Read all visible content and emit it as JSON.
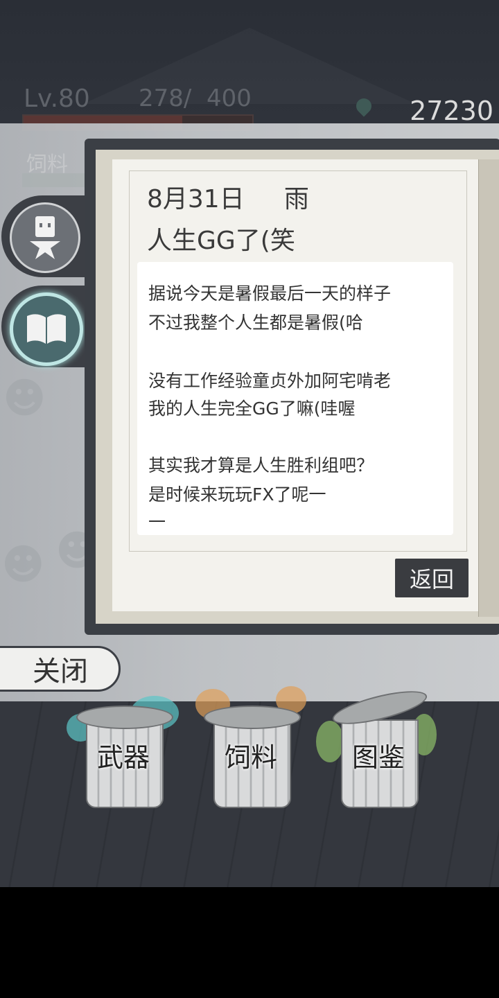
{
  "hud": {
    "level": "Lv.80",
    "exp": "278/  400",
    "exp_progress": 0.695,
    "coins": "27230"
  },
  "diary": {
    "date": "8月31日     雨",
    "title": "人生GG了(笑",
    "lines": [
      "据说今天是暑假最后一天的样子",
      "不过我整个人生都是暑假(哈",
      "",
      "没有工作经验童贞外加阿宅啃老",
      "我的人生完全GG了嘛(哇喔",
      "",
      "其实我才算是人生胜利组吧？",
      "是时候来玩玩FX了呢一",
      "一"
    ],
    "back_label": "返回"
  },
  "close_label": "关闭",
  "cans": [
    {
      "label": "武器",
      "accent": "#5cc6c8"
    },
    {
      "label": "饲料",
      "accent": "#e0a05a"
    },
    {
      "label": "图鉴",
      "accent": "#8fbf6a"
    }
  ]
}
